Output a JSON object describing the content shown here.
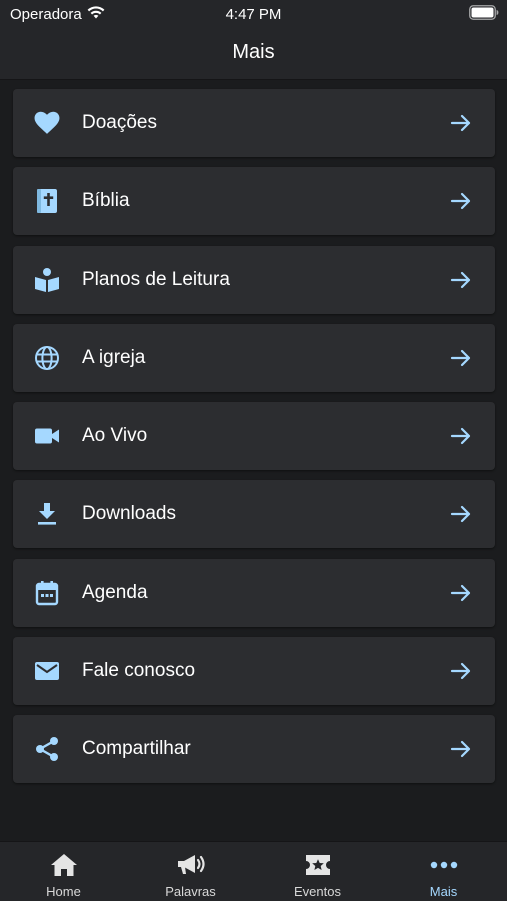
{
  "status_bar": {
    "carrier": "Operadora",
    "time": "4:47 PM"
  },
  "nav": {
    "title": "Mais"
  },
  "menu": [
    {
      "label": "Doações",
      "icon": "heart-icon"
    },
    {
      "label": "Bíblia",
      "icon": "bible-icon"
    },
    {
      "label": "Planos de Leitura",
      "icon": "reading-plan-icon"
    },
    {
      "label": "A igreja",
      "icon": "globe-icon"
    },
    {
      "label": "Ao Vivo",
      "icon": "video-camera-icon"
    },
    {
      "label": "Downloads",
      "icon": "download-icon"
    },
    {
      "label": "Agenda",
      "icon": "calendar-icon"
    },
    {
      "label": "Fale conosco",
      "icon": "mail-icon"
    },
    {
      "label": "Compartilhar",
      "icon": "share-icon"
    }
  ],
  "tabs": [
    {
      "label": "Home",
      "icon": "home-icon"
    },
    {
      "label": "Palavras",
      "icon": "megaphone-icon"
    },
    {
      "label": "Eventos",
      "icon": "ticket-star-icon"
    },
    {
      "label": "Mais",
      "icon": "more-dots-icon",
      "active": true
    }
  ],
  "colors": {
    "accent": "#a5d8ff",
    "background": "#1b1c1e",
    "card": "#2c2d30",
    "bar": "#252629"
  }
}
